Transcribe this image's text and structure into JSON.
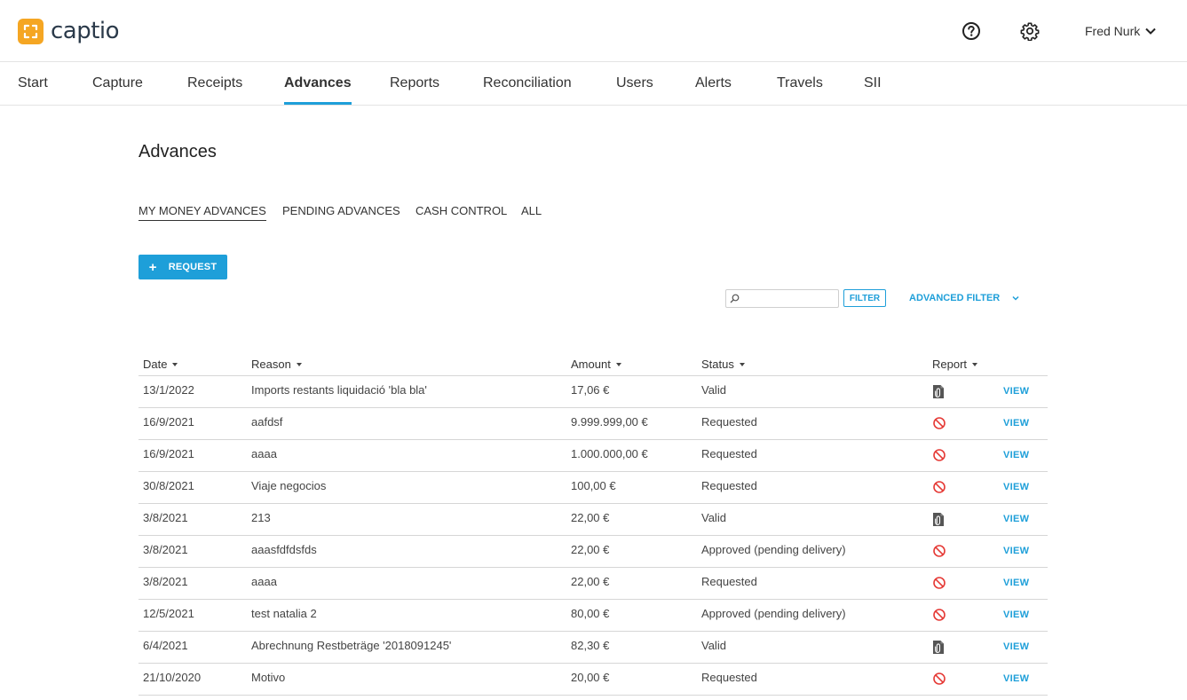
{
  "app": {
    "logo_text": "captio",
    "brand_color": "#f5a623",
    "accent_color": "#1e9fd9",
    "user_name": "Fred Nurk"
  },
  "nav": {
    "items": [
      "Start",
      "Capture",
      "Receipts",
      "Advances",
      "Reports",
      "Reconciliation",
      "Users",
      "Alerts",
      "Travels",
      "SII"
    ],
    "active": "Advances"
  },
  "page": {
    "title": "Advances",
    "subtabs": [
      "MY MONEY ADVANCES",
      "PENDING ADVANCES",
      "CASH CONTROL",
      "ALL"
    ],
    "active_subtab": "MY MONEY ADVANCES",
    "request_button": "REQUEST",
    "request_icon": "plus-icon"
  },
  "filter": {
    "search_value": "",
    "search_placeholder": "",
    "filter_button": "FILTER",
    "advanced_filter": "ADVANCED FILTER"
  },
  "table": {
    "columns": [
      "Date",
      "Reason",
      "Amount",
      "Status",
      "Report"
    ],
    "view_label": "VIEW",
    "rows": [
      {
        "date": "13/1/2022",
        "reason": "Imports restants liquidació 'bla bla'",
        "amount": "17,06 €",
        "status": "Valid",
        "report_icon": "document-clip-icon"
      },
      {
        "date": "16/9/2021",
        "reason": "aafdsf",
        "amount": "9.999.999,00 €",
        "status": "Requested",
        "report_icon": "prohibited-icon"
      },
      {
        "date": "16/9/2021",
        "reason": "aaaa",
        "amount": "1.000.000,00 €",
        "status": "Requested",
        "report_icon": "prohibited-icon"
      },
      {
        "date": "30/8/2021",
        "reason": "Viaje negocios",
        "amount": "100,00 €",
        "status": "Requested",
        "report_icon": "prohibited-icon"
      },
      {
        "date": "3/8/2021",
        "reason": "213",
        "amount": "22,00 €",
        "status": "Valid",
        "report_icon": "document-clip-icon"
      },
      {
        "date": "3/8/2021",
        "reason": "aaasfdfdsfds",
        "amount": "22,00 €",
        "status": "Approved (pending delivery)",
        "report_icon": "prohibited-icon"
      },
      {
        "date": "3/8/2021",
        "reason": "aaaa",
        "amount": "22,00 €",
        "status": "Requested",
        "report_icon": "prohibited-icon"
      },
      {
        "date": "12/5/2021",
        "reason": "test natalia 2",
        "amount": "80,00 €",
        "status": "Approved (pending delivery)",
        "report_icon": "prohibited-icon"
      },
      {
        "date": "6/4/2021",
        "reason": "Abrechnung Restbeträge '2018091245'",
        "amount": "82,30 €",
        "status": "Valid",
        "report_icon": "document-clip-icon"
      },
      {
        "date": "21/10/2020",
        "reason": "Motivo",
        "amount": "20,00 €",
        "status": "Requested",
        "report_icon": "prohibited-icon"
      }
    ]
  }
}
